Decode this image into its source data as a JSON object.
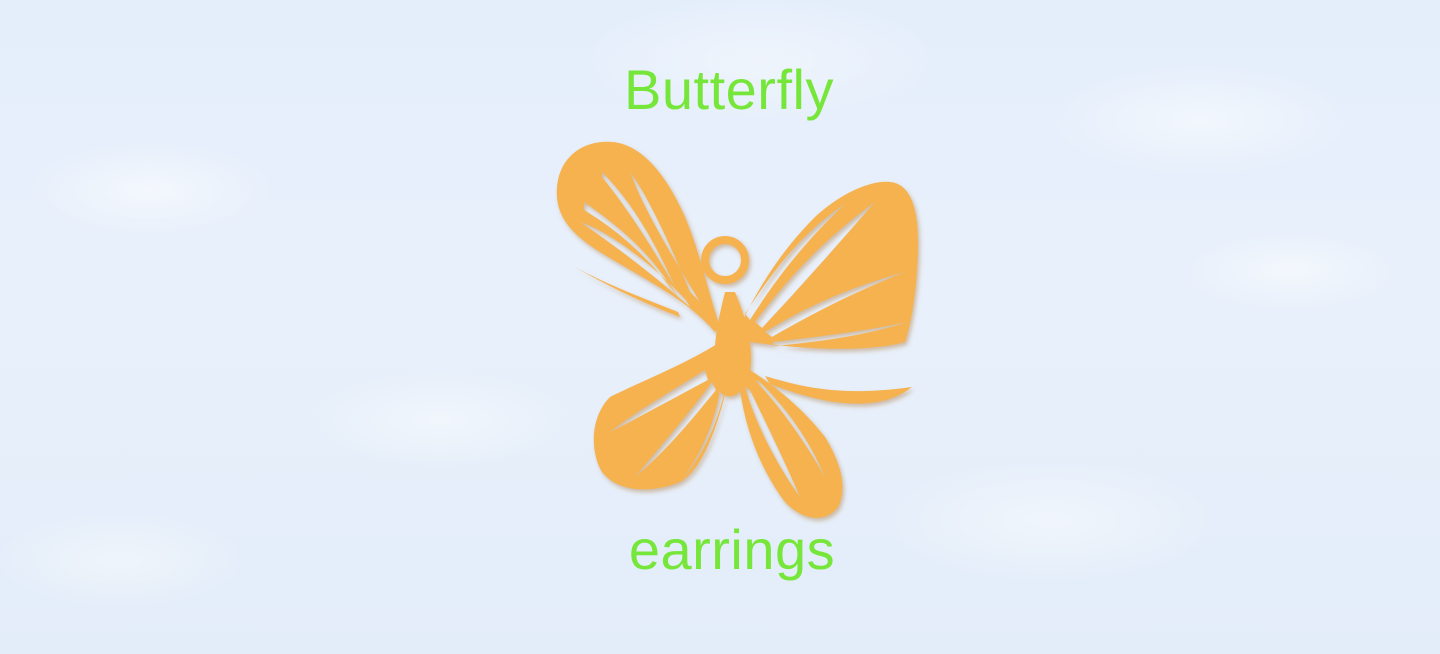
{
  "photo": {
    "subject": "butterfly-pendant",
    "background_color": "#e6eefa",
    "caption_color": "#77e63a",
    "pendant_color": "#f5b24f"
  },
  "caption": {
    "top": "Butterfly",
    "bottom": "earrings"
  }
}
